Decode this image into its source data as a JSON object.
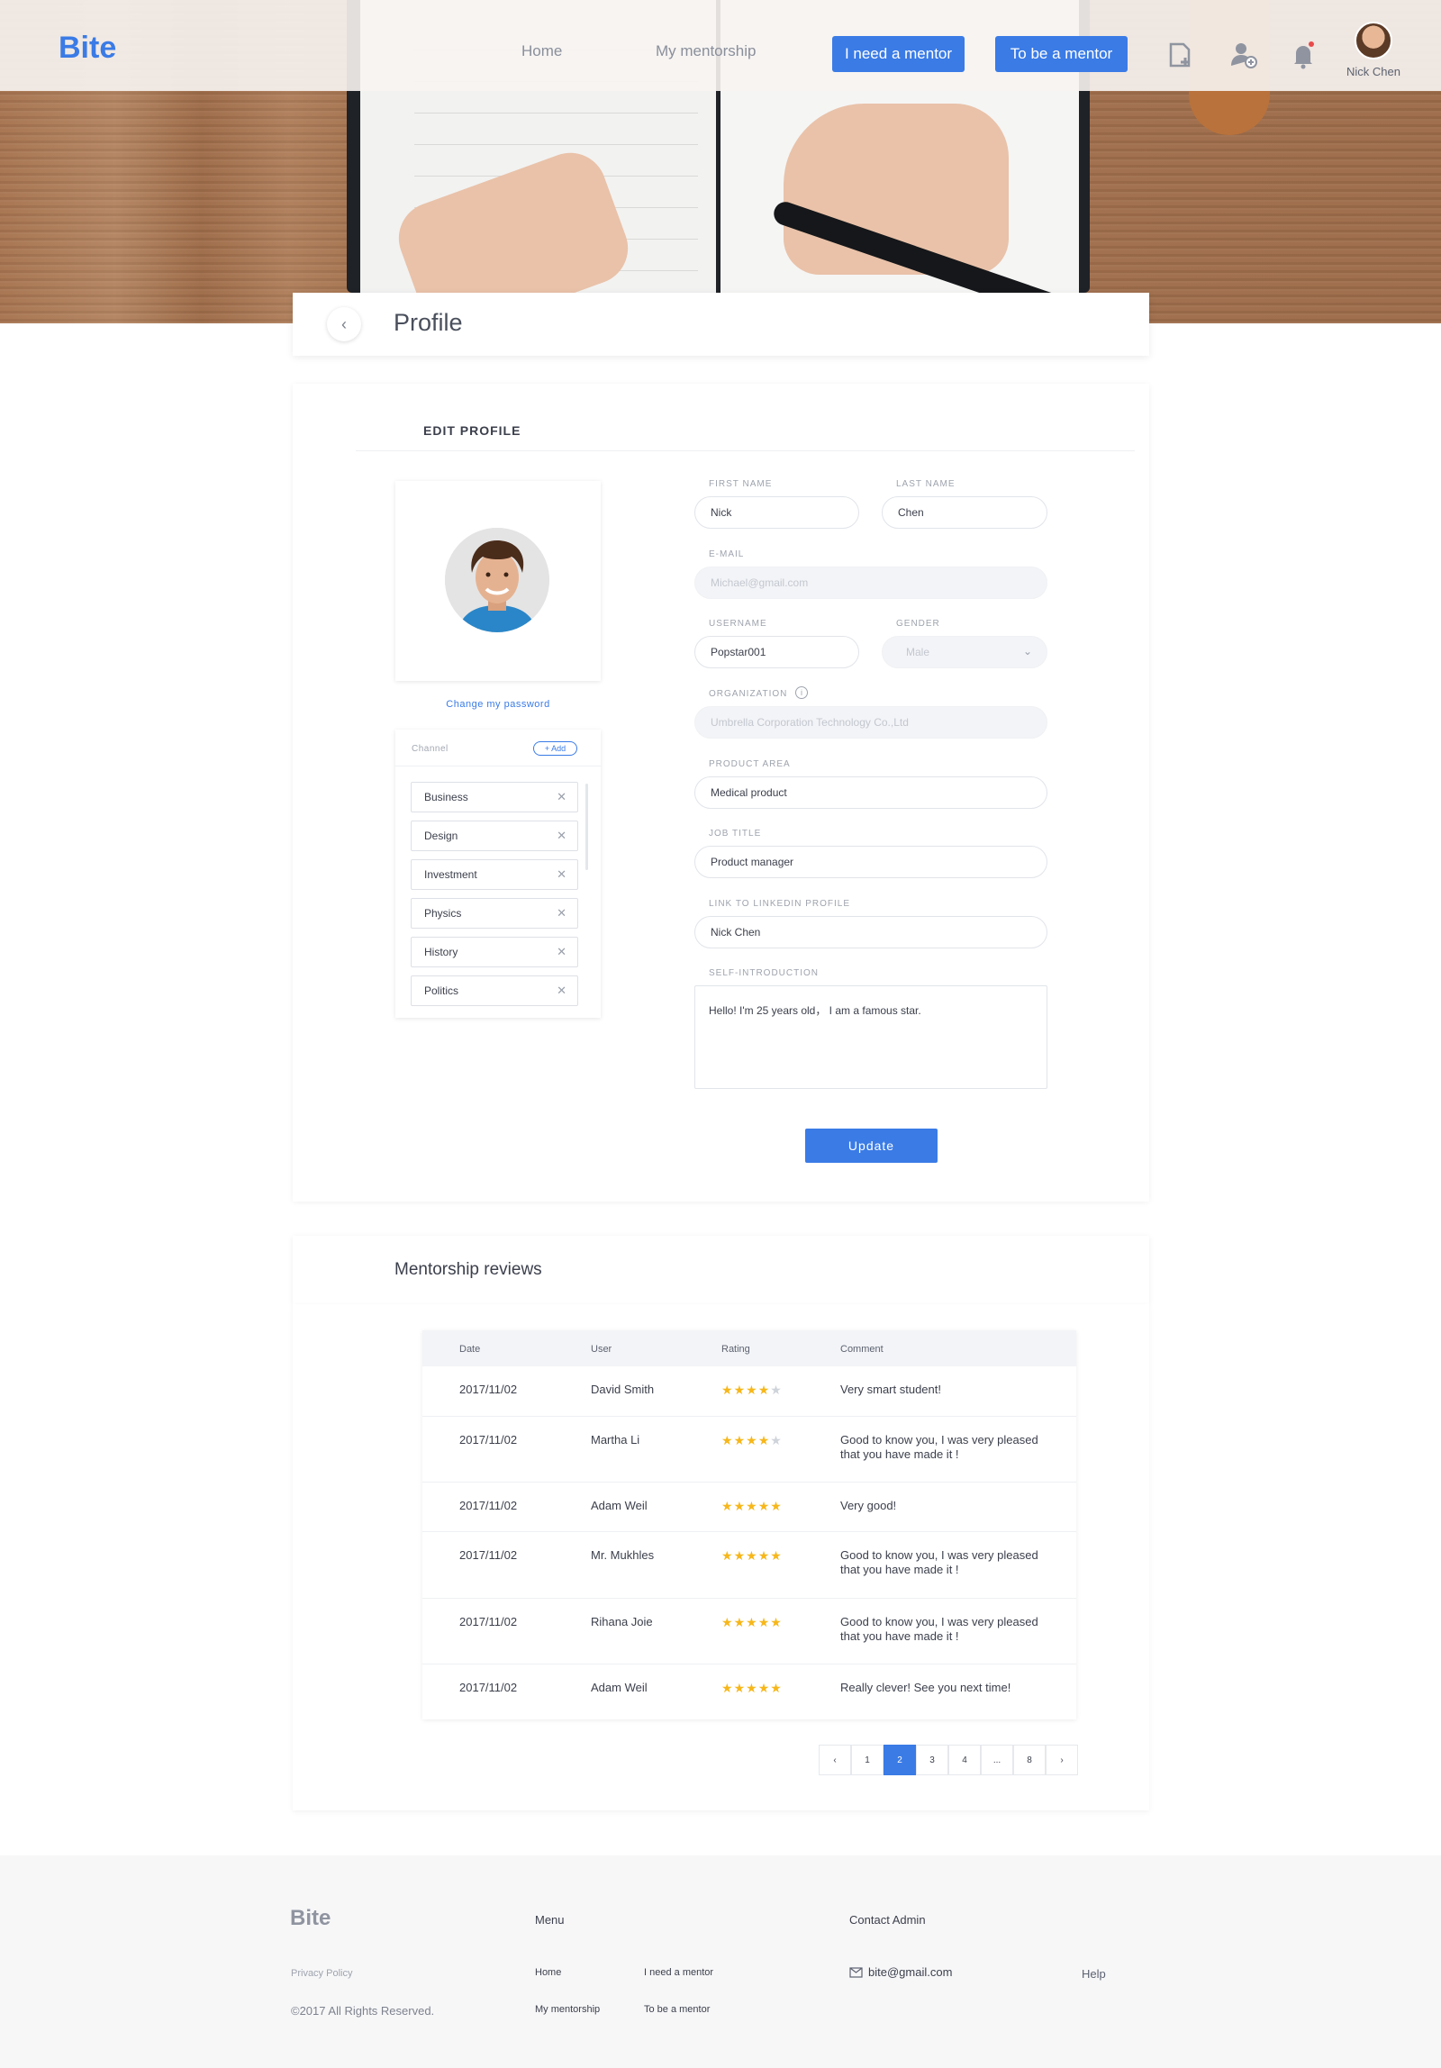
{
  "nav": {
    "logo": "Bite",
    "links": [
      "Home",
      "My mentorship"
    ],
    "btn_need": "I need a mentor",
    "btn_be": "To be a mentor",
    "user_name": "Nick Chen"
  },
  "page": {
    "title": "Profile"
  },
  "edit": {
    "section_title": "EDIT PROFILE",
    "change_password": "Change my password",
    "channel_label": "Channel",
    "add_label": "+ Add",
    "channels": [
      "Business",
      "Design",
      "Investment",
      "Physics",
      "History",
      "Politics"
    ],
    "first_name_label": "FIRST NAME",
    "first_name": "Nick",
    "last_name_label": "LAST NAME",
    "last_name": "Chen",
    "email_label": "E-MAIL",
    "email": "Michael@gmail.com",
    "username_label": "USERNAME",
    "username": "Popstar001",
    "gender_label": "GENDER",
    "gender": "Male",
    "org_label": "ORGANIZATION",
    "org": "Umbrella Corporation Technology Co.,Ltd",
    "product_area_label": "PRODUCT AREA",
    "product_area": "Medical product",
    "job_title_label": "JOB TITLE",
    "job_title": "Product manager",
    "linkedin_label": "LINK TO LINKEDIN PROFILE",
    "linkedin": "Nick Chen",
    "intro_label": "SELF-INTRODUCTION",
    "intro": "Hello! I'm 25 years old，  I am a famous star.",
    "update_label": "Update"
  },
  "reviews": {
    "title": "Mentorship reviews",
    "headers": [
      "Date",
      "User",
      "Rating",
      "Comment"
    ],
    "rows": [
      {
        "date": "2017/11/02",
        "user": "David Smith",
        "rating": 4,
        "comment": "Very smart student!"
      },
      {
        "date": "2017/11/02",
        "user": "Martha Li",
        "rating": 4,
        "comment": "Good to know you, I was very pleased that you have made it !"
      },
      {
        "date": "2017/11/02",
        "user": "Adam Weil",
        "rating": 5,
        "comment": "Very good!"
      },
      {
        "date": "2017/11/02",
        "user": "Mr. Mukhles",
        "rating": 5,
        "comment": "Good to know you, I was very pleased that you have made it !"
      },
      {
        "date": "2017/11/02",
        "user": "Rihana Joie",
        "rating": 5,
        "comment": "Good to know you, I was very pleased that you have made it !"
      },
      {
        "date": "2017/11/02",
        "user": "Adam Weil",
        "rating": 5,
        "comment": "Really clever! See you next time!"
      }
    ],
    "pagination": {
      "prev": "‹",
      "next": "›",
      "pages": [
        "1",
        "2",
        "3",
        "4",
        "...",
        "8"
      ],
      "current": "2"
    }
  },
  "footer": {
    "logo": "Bite",
    "privacy": "Privacy Policy",
    "copyright": "©2017 All Rights Reserved.",
    "menu_title": "Menu",
    "menu_home": "Home",
    "menu_need": "I need a mentor",
    "menu_mentorship": "My mentorship",
    "menu_be": "To be a mentor",
    "contact_title": "Contact Admin",
    "email": "bite@gmail.com",
    "help": "Help"
  },
  "colors": {
    "accent": "#3a7be6",
    "star": "#f6b71b"
  }
}
